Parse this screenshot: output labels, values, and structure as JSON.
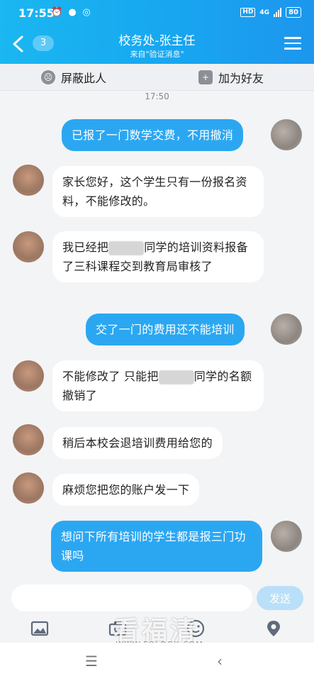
{
  "status_bar": {
    "time": "17:55",
    "network": "4G",
    "battery": "80"
  },
  "header": {
    "back_label": "<",
    "unread_count": "3",
    "title": "校务处-张主任",
    "subtitle": "来自\"验证消息\""
  },
  "actions": {
    "block_label": "屏蔽此人",
    "add_friend_label": "加为好友"
  },
  "timestamp": "17:50",
  "messages": [
    {
      "direction": "out",
      "text": "已报了一门数学交费，不用撤消"
    },
    {
      "direction": "in",
      "text": "家长您好，这个学生只有一份报名资料，不能修改的。"
    },
    {
      "direction": "in",
      "text_before": "我已经把",
      "text_after": "同学的培训资料报备了三科课程交到教育局审核了"
    },
    {
      "direction": "out",
      "text": "交了一门的费用还不能培训"
    },
    {
      "direction": "in",
      "text_before": "不能修改了 只能把",
      "text_after": "同学的名额撤销了"
    },
    {
      "direction": "in",
      "text": "稍后本校会退培训费用给您的"
    },
    {
      "direction": "in",
      "text": "麻烦您把您的账户发一下"
    },
    {
      "direction": "out",
      "text": "想问下所有培训的学生都是报三门功课吗"
    }
  ],
  "composer": {
    "input_value": "",
    "send_label": "发送"
  },
  "toolbar_icons": [
    "image-icon",
    "camera-icon",
    "emoji-icon",
    "location-icon"
  ],
  "watermark": {
    "text": "看福清",
    "url": "WWW.FQLOOK.COM"
  },
  "colors": {
    "header_blue": "#18a6f0",
    "bubble_out": "#2ba7f2",
    "bubble_in": "#ffffff",
    "send_disabled": "#b9e0f8"
  }
}
